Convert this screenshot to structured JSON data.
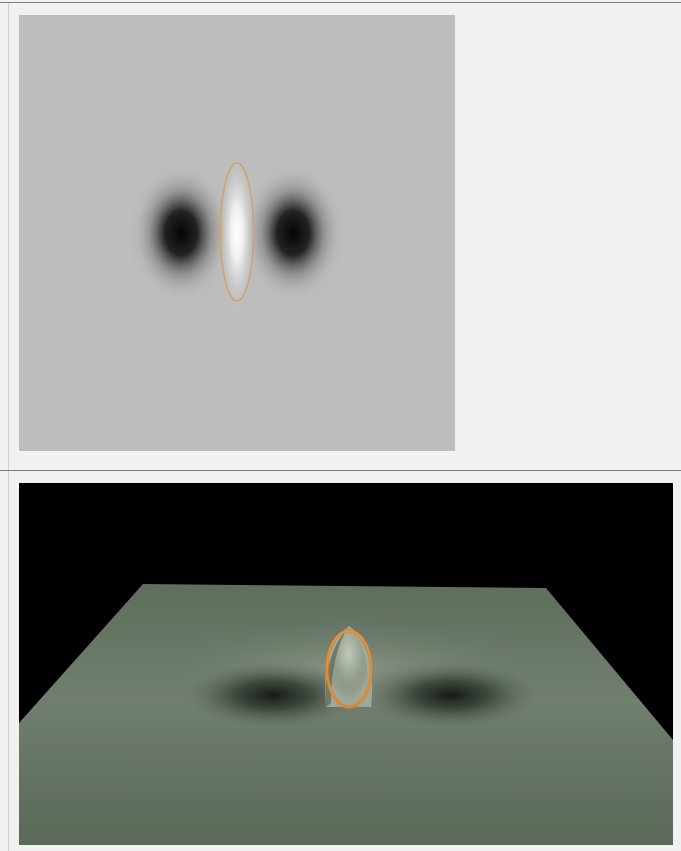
{
  "views": {
    "filter_2d": {
      "name": "2d-filter-heatmap",
      "background": "#bdbdbd",
      "palette": {
        "neutral": "#bdbdbd",
        "negative": "#050505",
        "positive": "#ffffff",
        "contour": "#d6a06a"
      }
    },
    "filter_3d": {
      "name": "3d-filter-surface",
      "background": "#000000",
      "palette": {
        "surface": "#6f7f6d",
        "surface_light": "#8a9a88",
        "shadow": "#1d241d",
        "contour": "#e88b2e"
      }
    }
  },
  "icons": {
    "contour": "orange-ellipse-outline-icon"
  }
}
